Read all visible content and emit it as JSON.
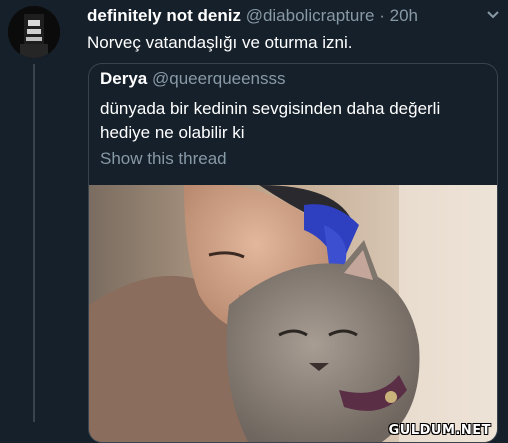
{
  "tweet": {
    "author_name": "definitely not deniz",
    "author_handle": "@diabolicrapture",
    "separator": "·",
    "time": "20h",
    "text": "Norveç vatandaşlığı ve oturma izni."
  },
  "quoted_tweet": {
    "author_name": "Derya",
    "author_handle": "@queerqueensss",
    "text": "dünyada bir kedinin sevgisinden daha değerli hediye ne olabilir ki",
    "show_thread_label": "Show this thread"
  },
  "watermark": "GULDUM.NET",
  "colors": {
    "background": "#15202b",
    "secondary_text": "#8899a6",
    "border": "#38444d",
    "hair_accent": "#3b4fd0"
  },
  "icons": {
    "more": "chevron-down-icon"
  }
}
